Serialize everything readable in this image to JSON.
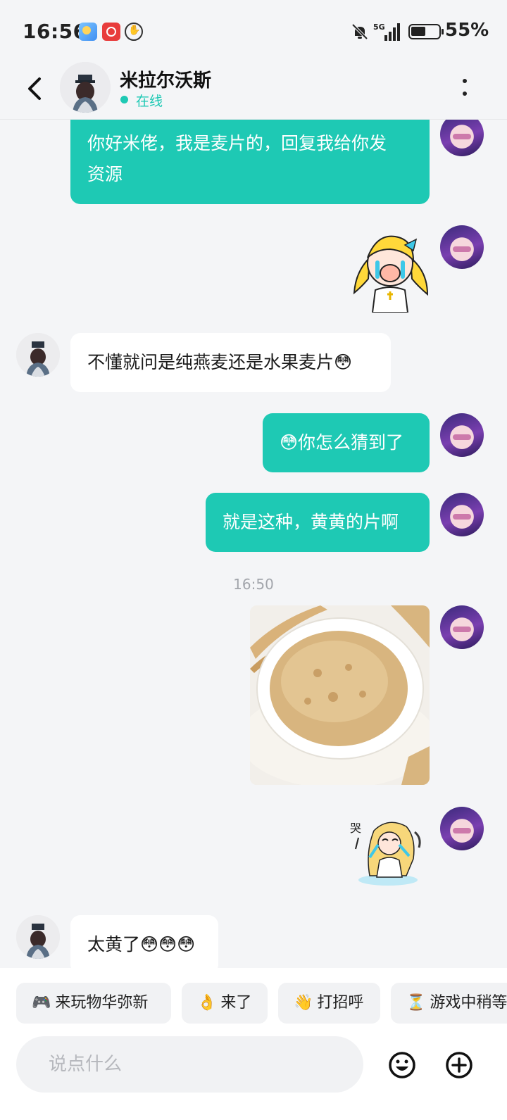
{
  "status_bar": {
    "time": "16:56",
    "battery": "55%",
    "network": "5G"
  },
  "header": {
    "name": "米拉尔沃斯",
    "status": "在线"
  },
  "messages": [
    {
      "side": "out",
      "text_line1": "你好米佬，我是麦片的，回复我给你发",
      "text_line2": "资源"
    },
    {
      "side": "out",
      "type": "sticker",
      "sticker": "crying-girl-sticker"
    },
    {
      "side": "in",
      "text": "不懂就问是纯燕麦还是水果麦片😳"
    },
    {
      "side": "out",
      "text": "😳你怎么猜到了"
    },
    {
      "side": "out",
      "text": "就是这种，黄黄的片啊"
    },
    {
      "side": "out",
      "type": "photo",
      "photo": "oat-flakes-bowl-photo"
    },
    {
      "side": "out",
      "type": "sticker",
      "sticker": "sobbing-girl-sticker"
    },
    {
      "side": "in",
      "text": "太黄了😳😳😳"
    }
  ],
  "time_divider": "16:50",
  "quick_replies": [
    {
      "emoji": "🎮",
      "label": "来玩物华弥新"
    },
    {
      "emoji": "👌",
      "label": "来了"
    },
    {
      "emoji": "👋",
      "label": "打招呼"
    },
    {
      "emoji": "⏳",
      "label": "游戏中稍等"
    }
  ],
  "input": {
    "placeholder": "说点什么",
    "value": ""
  },
  "colors": {
    "accent": "#1ec9b4",
    "background": "#f4f5f7",
    "bubble_in": "#ffffff"
  }
}
